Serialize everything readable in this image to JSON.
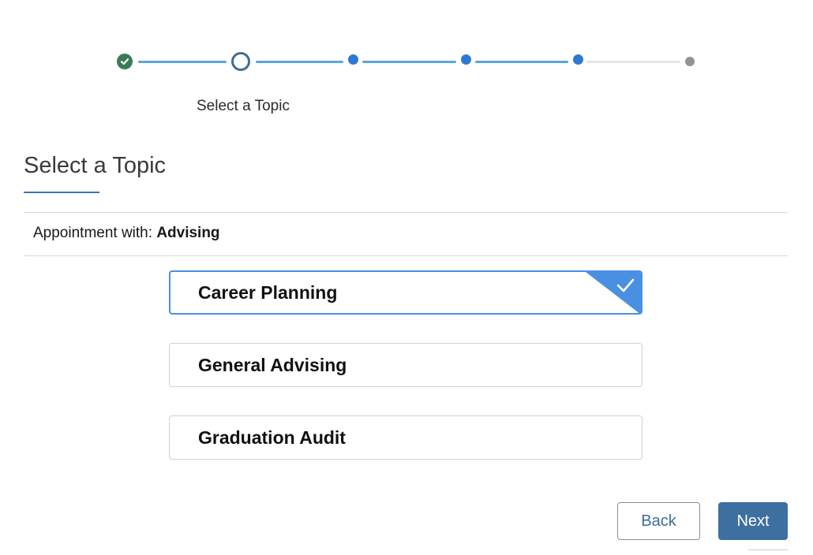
{
  "stepper": {
    "current_step_label": "Select a Topic",
    "colors": {
      "complete": "#3b7b56",
      "current_ring": "#3d6e97",
      "upcoming": "#2f78d2",
      "final": "#939393",
      "line_done": "#5aa5dc",
      "line_todo": "#e5e5e5"
    }
  },
  "header": {
    "title": "Select a Topic"
  },
  "appointment": {
    "label": "Appointment with:",
    "value": "Advising"
  },
  "topics": [
    {
      "label": "Career Planning",
      "selected": true
    },
    {
      "label": "General Advising",
      "selected": false
    },
    {
      "label": "Graduation Audit",
      "selected": false
    }
  ],
  "actions": {
    "back_label": "Back",
    "next_label": "Next"
  },
  "theme": {
    "accent": "#4a90e2",
    "primary_button": "#3d6fa0"
  }
}
